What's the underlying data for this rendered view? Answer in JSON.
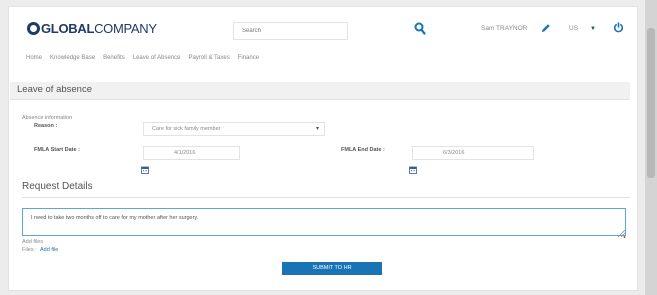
{
  "header": {
    "logo_bold": "GLOBAL",
    "logo_light": "COMPANY",
    "search_placeholder": "Search",
    "user_name": "Sam TRAYNOR",
    "language": "US"
  },
  "nav": {
    "items": [
      "Home",
      "Knowledge Base",
      "Benefits",
      "Leave of Absence",
      "Payroll & Taxes",
      "Finance"
    ]
  },
  "section": {
    "title": "Leave of absence"
  },
  "form": {
    "absence_info_label": "Absence information",
    "reason_label": "Reason :",
    "reason_value": "Care for sick family member",
    "fmla_start_label": "FMLA Start Date :",
    "fmla_start_value": "4/1/2016",
    "fmla_end_label": "FMLA End Date :",
    "fmla_end_value": "6/3/2016"
  },
  "request": {
    "title": "Request Details",
    "text": "I need to take two months off to care for my mother after her surgery.",
    "add_files_label": "Add files",
    "files_label": "Files :",
    "add_file_link": "Add file"
  },
  "submit_label": "SUBMIT TO HR",
  "colors": {
    "brand": "#1f3a66",
    "accent": "#1a73b5",
    "link": "#1a73b5"
  },
  "icons": [
    "search-icon",
    "pencil-icon",
    "power-icon",
    "calendar-icon",
    "chevron-down-icon"
  ]
}
